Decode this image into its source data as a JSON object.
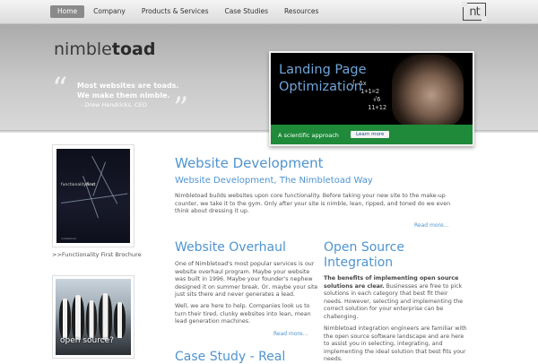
{
  "nav": {
    "items": [
      {
        "label": "Home",
        "active": true
      },
      {
        "label": "Company",
        "active": false
      },
      {
        "label": "Products & Services",
        "active": false
      },
      {
        "label": "Case Studies",
        "active": false
      },
      {
        "label": "Resources",
        "active": false
      }
    ],
    "logo_mark": "nt"
  },
  "header": {
    "brand_light": "nimble",
    "brand_bold": "toad",
    "quote_line1": "Most websites are toads.",
    "quote_line2": "We make them nimble.",
    "quote_author": "- Drew Hendricks, CEO",
    "quote_open": "“",
    "quote_close": "”"
  },
  "banner": {
    "title_line1": "Landing Page",
    "title_line2": "Optimization",
    "caption": "A scientific approach",
    "button_label": "Learn more",
    "scribble": "∫ Δx\n1+1=2\n√6\n11+12"
  },
  "sidebar": {
    "book_title_light": "functionality",
    "book_title_bold": "first",
    "book_sub": "nimbletoad",
    "book_caption": ">>Functionality First Brochure",
    "penguins_text": "open source?"
  },
  "main": {
    "heading": "Website Development",
    "subheading": "Website Development, The Nimbletoad Way",
    "intro": "Nimbletoad builds websites upon core functionality. Before taking your new site to the make-up counter, we take it to the gym. Only after your site is nimble, lean, ripped, and toned do we even think about dressing it up.",
    "read_more": "Read more...",
    "overhaul": {
      "heading": "Website Overhaul",
      "p1": "One of Nimbletoad's most popular services is our website overhaul program. Maybe your website was built in 1996. Maybe your founder's nephew designed it on summer break. Or, maybe your site just sits there and never generates a lead.",
      "p2": "Well, we are here to help. Companies look us to turn their tired, clunky websites into lean, mean lead generation machines.",
      "read_more": "Read more..."
    },
    "open_source": {
      "heading_line1": "Open Source",
      "heading_line2": "Integration",
      "p1_bold": "The benefits of implementing open source solutions are clear.",
      "p1_rest": " Businesses are free to pick solutions in each category that best fit their needs. However, selecting and implementing the correct solution for your enterprise can be challenging.",
      "p2": "Nimbletoad integration engineers are familiar with the open source software landscape and are here to assist you in selecting, integrating, and implementing the ideal solution that best fits your needs."
    },
    "case_study_heading": "Case Study - Real"
  }
}
